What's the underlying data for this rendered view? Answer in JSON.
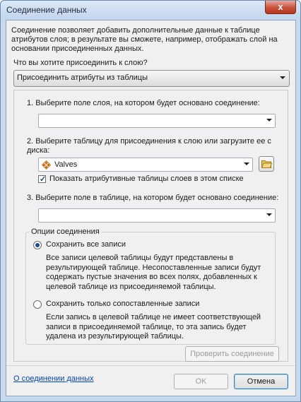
{
  "window": {
    "title": "Соединение данных",
    "close_glyph": "x"
  },
  "description": "Соединение позволяет добавить дополнительные данные к таблице атрибутов слоя; в результате вы сможете, например, отображать слой на основании присоединенных данных.",
  "join_question": "Что вы хотите присоединить к слою?",
  "join_type": {
    "selected": "Присоединить атрибуты из таблицы"
  },
  "steps": {
    "step1_label": "1.  Выберите поле слоя, на котором будет основано соединение:",
    "step1_value": "",
    "step2_label": "2.  Выберите таблицу для присоединения к слою или загрузите ее с диска:",
    "step2_table": "Valves",
    "step2_table_icon": "layer-diamond-icon",
    "show_attr_tables_label": "Показать атрибутивные таблицы слоев в этом списке",
    "show_attr_tables_checked": true,
    "step3_label": "3.  Выберите поле в таблице, на котором будет основано соединение:",
    "step3_value": ""
  },
  "join_options": {
    "title": "Опции соединения",
    "keep_all": {
      "label": "Сохранить все записи",
      "selected": true,
      "description": "Все записи целевой таблицы будут представлены в результирующей таблице. Несопоставленные записи будут содержать пустые значения во всех полях, добавленных к целевой таблице из присоединяемой таблицы."
    },
    "keep_matching": {
      "label": "Сохранить только сопоставленные записи",
      "selected": false,
      "description": "Если запись в целевой таблице не имеет соответствующей записи в присоединяемой таблице, то эта запись будет удалена из результирующей таблицы."
    }
  },
  "validate_button": "Проверить соединение",
  "footer": {
    "about_link": "О соединении данных",
    "ok": "OK",
    "cancel": "Отмена"
  },
  "colors": {
    "accent": "#1c4a96",
    "link": "#0645ad",
    "close": "#c6503a"
  }
}
